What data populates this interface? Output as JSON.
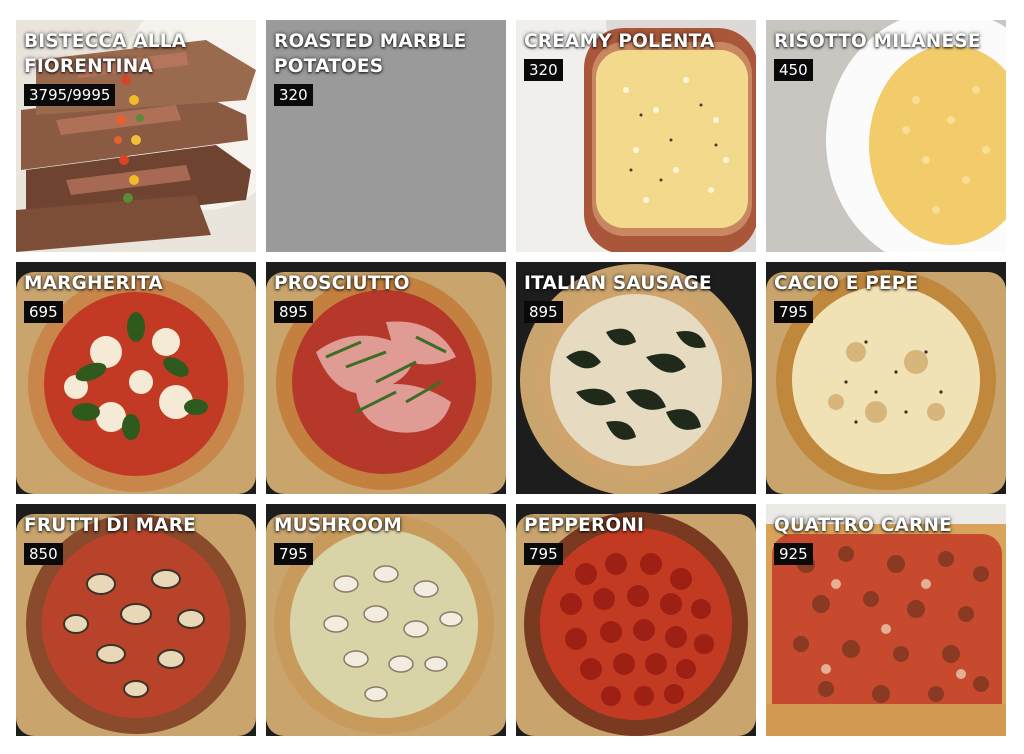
{
  "menu": {
    "items": [
      {
        "name": "BISTECCA ALLA FIORENTINA",
        "price": "3795/9995",
        "image": "steak"
      },
      {
        "name": "ROASTED MARBLE POTATOES",
        "price": "320",
        "image": "placeholder"
      },
      {
        "name": "CREAMY POLENTA",
        "price": "320",
        "image": "polenta"
      },
      {
        "name": "RISOTTO MILANESE",
        "price": "450",
        "image": "risotto"
      },
      {
        "name": "MARGHERITA",
        "price": "695",
        "image": "pizza-margherita"
      },
      {
        "name": "PROSCIUTTO",
        "price": "895",
        "image": "pizza-prosciutto"
      },
      {
        "name": "ITALIAN SAUSAGE",
        "price": "895",
        "image": "pizza-sausage"
      },
      {
        "name": "CACIO E PEPE",
        "price": "795",
        "image": "pizza-cacio-e-pepe"
      },
      {
        "name": "FRUTTI DI MARE",
        "price": "850",
        "image": "pizza-frutti-di-mare"
      },
      {
        "name": "MUSHROOM",
        "price": "795",
        "image": "pizza-mushroom"
      },
      {
        "name": "PEPPERONI",
        "price": "795",
        "image": "pizza-pepperoni"
      },
      {
        "name": "QUATTRO CARNE",
        "price": "925",
        "image": "pizza-quattro-carne"
      }
    ]
  },
  "colors": {
    "placeholder_gray": "#9a9a9a",
    "price_badge_bg": "#0a0a0a",
    "title_text": "#ffffff"
  }
}
